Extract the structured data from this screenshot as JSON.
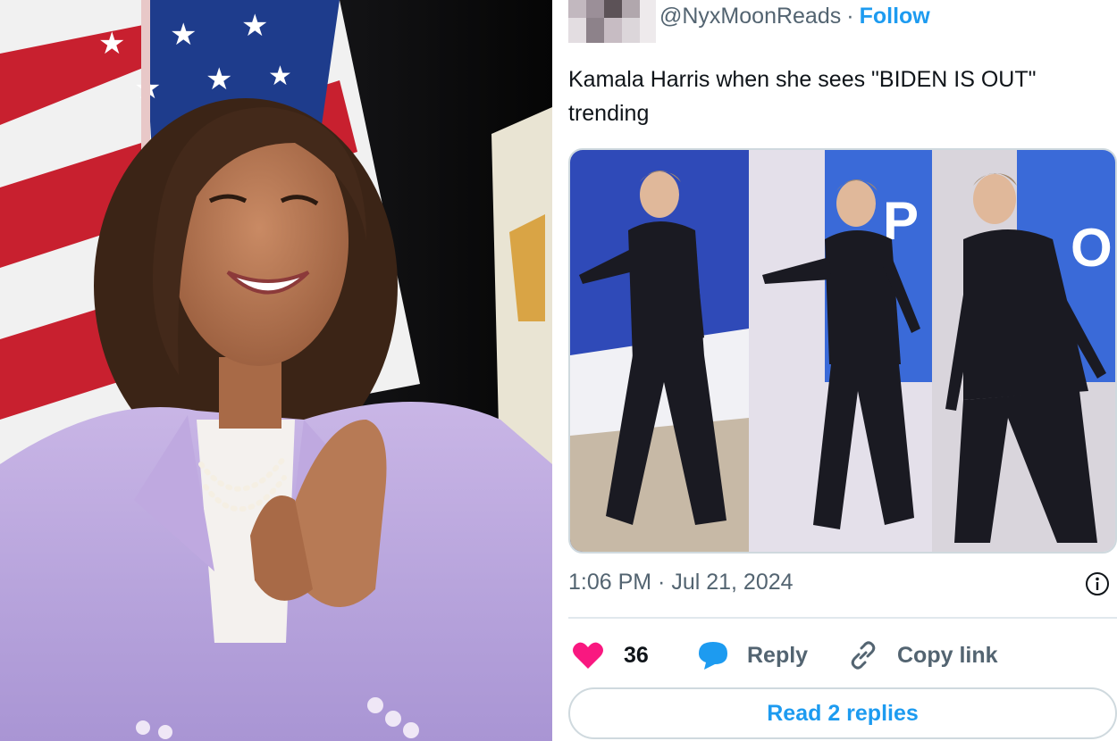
{
  "photo": {
    "subject": "smiling woman in lavender suit clapping",
    "background": "american flag"
  },
  "tweet": {
    "handle": "@NyxMoonReads",
    "separator": "·",
    "follow_label": "Follow",
    "text": "Kamala Harris when she sees \"BIDEN IS OUT\" trending",
    "media_alt": "three photos of a woman in a dark suit dancing on stage",
    "timestamp": "1:06 PM · Jul 21, 2024",
    "like_count": "36",
    "reply_label": "Reply",
    "copy_link_label": "Copy link",
    "read_replies_label": "Read 2 replies"
  },
  "colors": {
    "accent": "#1d9bf0",
    "like": "#f91880",
    "muted_text": "#536471",
    "text": "#0f1419"
  },
  "icons": {
    "like": "heart-icon",
    "reply": "speech-bubble-icon",
    "copy": "link-icon",
    "info": "info-icon"
  }
}
